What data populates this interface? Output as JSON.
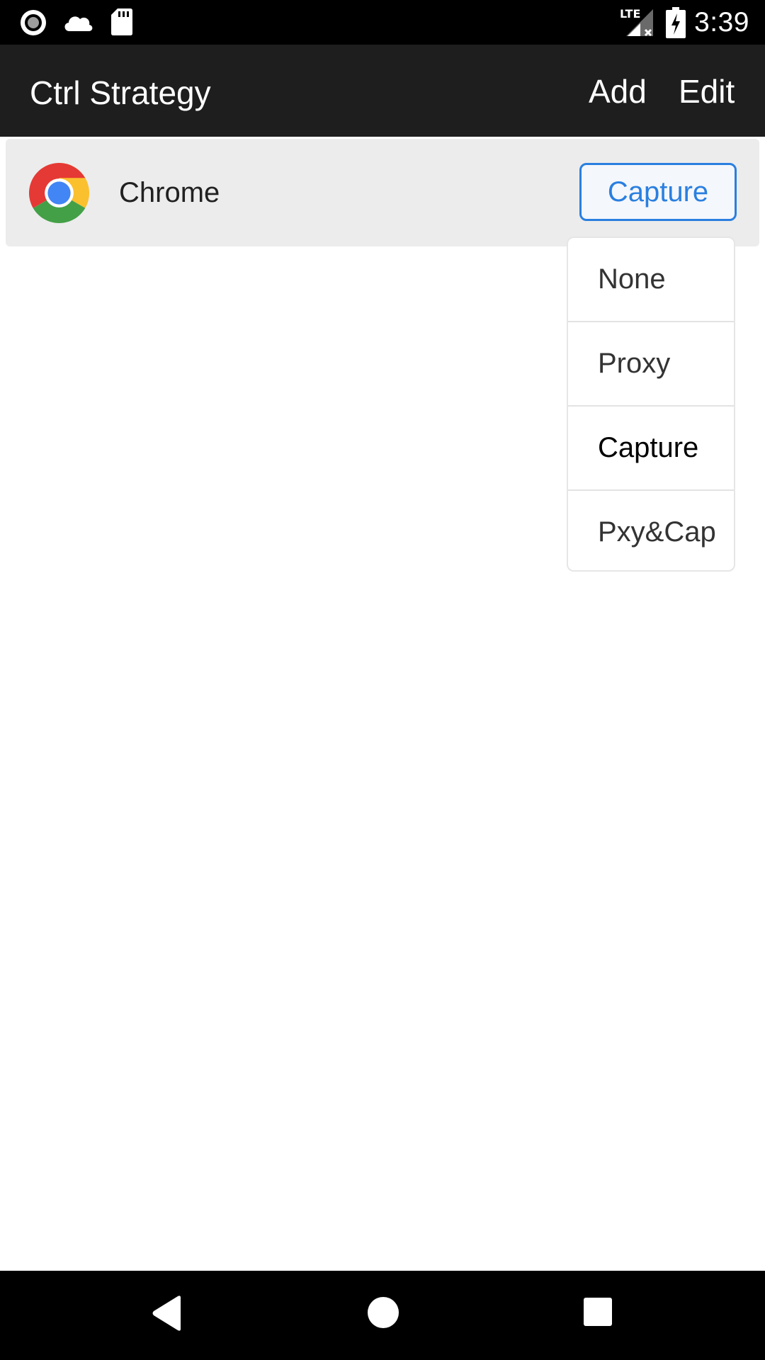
{
  "status_bar": {
    "time": "3:39",
    "icons": [
      "record-icon",
      "cloud-icon",
      "sd-card-icon",
      "lte-signal-icon",
      "battery-charging-icon"
    ],
    "lte_label": "LTE"
  },
  "app_bar": {
    "title": "Ctrl Strategy",
    "actions": {
      "add": "Add",
      "edit": "Edit"
    }
  },
  "apps": [
    {
      "name": "Chrome",
      "icon": "chrome-icon",
      "strategy": "Capture"
    }
  ],
  "dropdown": {
    "options": [
      "None",
      "Proxy",
      "Capture",
      "Pxy&Cap"
    ],
    "selected": "Capture"
  },
  "nav_bar": {
    "icons": [
      "back-icon",
      "home-icon",
      "recents-icon"
    ]
  },
  "colors": {
    "accent": "#2a7fe0",
    "app_bar": "#1e1e1e",
    "row_background": "#ececec"
  }
}
